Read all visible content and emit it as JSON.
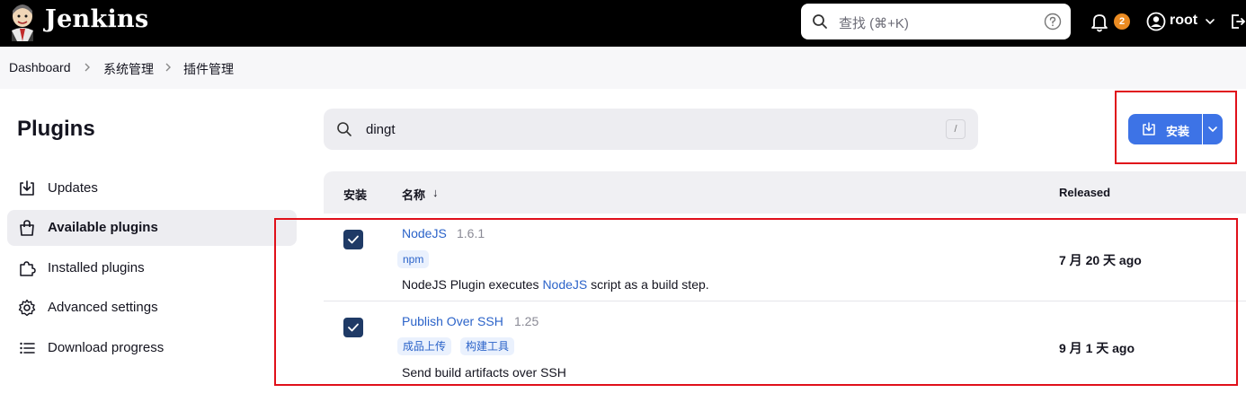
{
  "header": {
    "brand": "Jenkins",
    "search_placeholder": "查找 (⌘+K)",
    "notification_count": "2",
    "user": "root",
    "icons": [
      "jenkins-logo",
      "search-icon",
      "help-icon",
      "bell-icon",
      "user-icon",
      "chevron-down-icon",
      "logout-icon"
    ]
  },
  "breadcrumb": [
    "Dashboard",
    "系统管理",
    "插件管理"
  ],
  "sidebar": {
    "title": "Plugins",
    "items": [
      {
        "label": "Updates",
        "icon": "download-icon",
        "active": false
      },
      {
        "label": "Available plugins",
        "icon": "shopping-bag-icon",
        "active": true
      },
      {
        "label": "Installed plugins",
        "icon": "puzzle-icon",
        "active": false
      },
      {
        "label": "Advanced settings",
        "icon": "gear-icon",
        "active": false
      },
      {
        "label": "Download progress",
        "icon": "list-icon",
        "active": false
      }
    ]
  },
  "filter": {
    "value": "dingt",
    "shortcut": "/"
  },
  "install_button": {
    "label": "安装"
  },
  "table": {
    "headers": {
      "install": "安装",
      "name": "名称",
      "sort_arrow": "↓",
      "released": "Released"
    },
    "rows": [
      {
        "checked": true,
        "name": "NodeJS",
        "version": "1.6.1",
        "tags": [
          "npm"
        ],
        "desc_pre": "NodeJS Plugin executes ",
        "desc_link": "NodeJS",
        "desc_post": " script as a build step.",
        "released": "7 月 20 天 ago"
      },
      {
        "checked": true,
        "name": "Publish Over SSH",
        "version": "1.25",
        "tags": [
          "成品上传",
          "构建工具"
        ],
        "desc_pre": "Send build artifacts over SSH",
        "desc_link": "",
        "desc_post": "",
        "released": "9 月 1 天 ago"
      }
    ]
  },
  "colors": {
    "accent": "#3d73e6",
    "checkbox": "#1f3a66",
    "link": "#2b63c9",
    "annotation": "#e0101a",
    "badge": "#ea8b22"
  }
}
